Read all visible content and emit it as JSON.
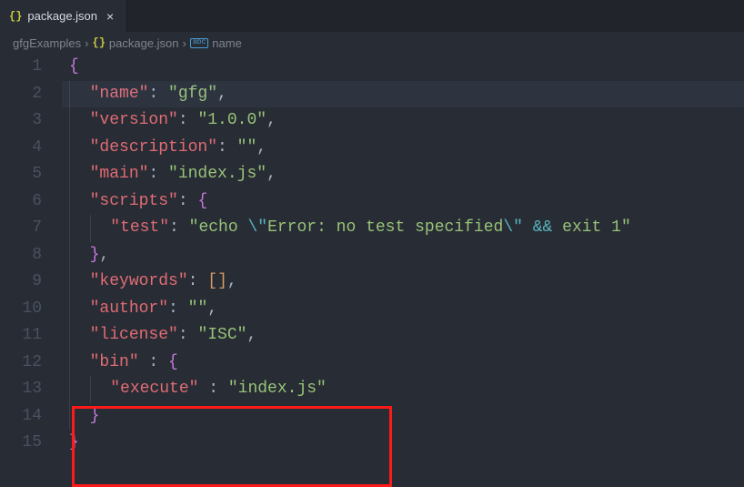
{
  "tab": {
    "filename": "package.json",
    "icon": "{}",
    "close": "×"
  },
  "breadcrumb": {
    "crumb1": "gfgExamples",
    "crumb2": "package.json",
    "crumb3": "name",
    "chev": "›",
    "icon2": "{}",
    "icon3": "abc"
  },
  "gutter": [
    "1",
    "2",
    "3",
    "4",
    "5",
    "6",
    "7",
    "8",
    "9",
    "10",
    "11",
    "12",
    "13",
    "14",
    "15"
  ],
  "code": {
    "l1": {
      "brace": "{"
    },
    "l2": {
      "key": "\"name\"",
      "colon": ": ",
      "val": "\"gfg\"",
      "comma": ","
    },
    "l3": {
      "key": "\"version\"",
      "colon": ": ",
      "val": "\"1.0.0\"",
      "comma": ","
    },
    "l4": {
      "key": "\"description\"",
      "colon": ": ",
      "val": "\"\"",
      "comma": ","
    },
    "l5": {
      "key": "\"main\"",
      "colon": ": ",
      "val": "\"index.js\"",
      "comma": ","
    },
    "l6": {
      "key": "\"scripts\"",
      "colon": ": ",
      "brace": "{"
    },
    "l7": {
      "key": "\"test\"",
      "colon": ": ",
      "valA": "\"echo ",
      "esc1": "\\\"",
      "valB": "Error: no test specified",
      "esc2": "\\\"",
      "valC": " ",
      "op": "&&",
      "valD": " exit 1\""
    },
    "l8": {
      "brace": "}",
      "comma": ","
    },
    "l9": {
      "key": "\"keywords\"",
      "colon": ": ",
      "lb": "[",
      "rb": "]",
      "comma": ","
    },
    "l10": {
      "key": "\"author\"",
      "colon": ": ",
      "val": "\"\"",
      "comma": ","
    },
    "l11": {
      "key": "\"license\"",
      "colon": ": ",
      "val": "\"ISC\"",
      "comma": ","
    },
    "l12": {
      "key": "\"bin\"",
      "colon": " : ",
      "brace": "{"
    },
    "l13": {
      "key": "\"execute\"",
      "colon": " : ",
      "val": "\"index.js\""
    },
    "l14": {
      "brace": "}"
    },
    "l15": {
      "brace": "}"
    }
  }
}
